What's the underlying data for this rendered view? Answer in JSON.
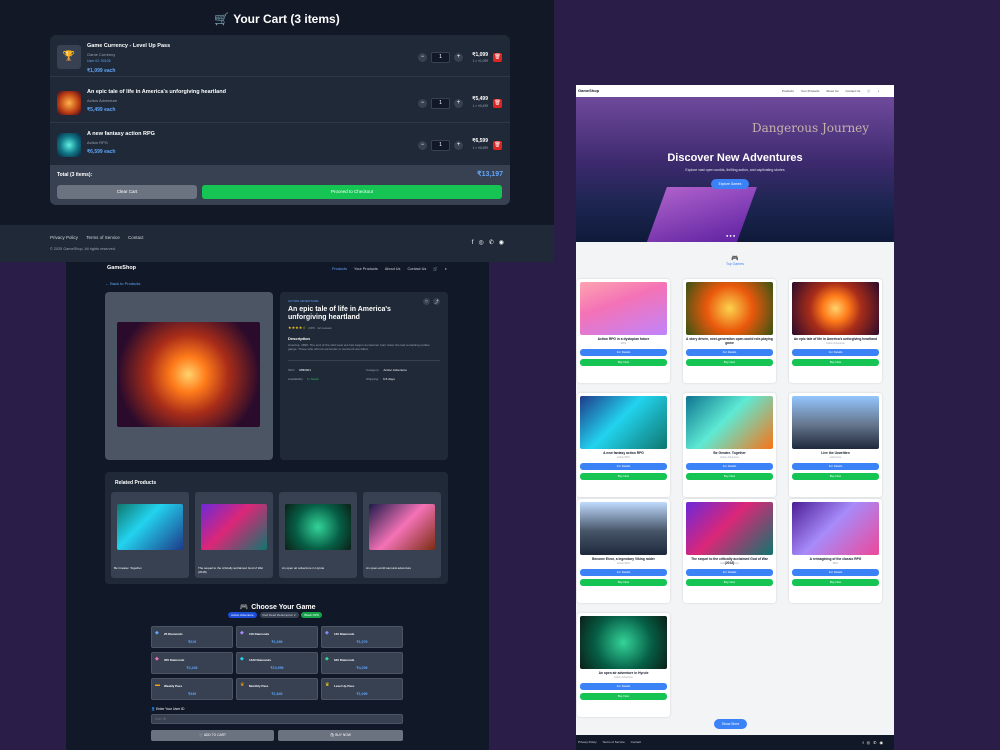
{
  "cart": {
    "title": "Your Cart (3 items)",
    "items": [
      {
        "name": "Game Currency - Level Up Pass",
        "category": "Game Currency",
        "user_id": "User ID: 90105",
        "price": "₹1,099 each",
        "qty": "1",
        "line_total": "₹1,099",
        "line_sub": "1 × ₹1,099"
      },
      {
        "name": "An epic tale of life in America's unforgiving heartland",
        "category": "Action Adventure",
        "user_id": "",
        "price": "₹5,499 each",
        "qty": "1",
        "line_total": "₹5,499",
        "line_sub": "1 × ₹5,499"
      },
      {
        "name": "A new fantasy action RPG",
        "category": "Action RPG",
        "user_id": "",
        "price": "₹6,599 each",
        "qty": "1",
        "line_total": "₹6,599",
        "line_sub": "1 × ₹6,599"
      }
    ],
    "total_label": "Total (3 items):",
    "total_value": "₹13,197",
    "clear_label": "Clear Cart",
    "checkout_label": "Proceed to Checkout",
    "footer_links": [
      "Privacy Policy",
      "Terms of Service",
      "Contact"
    ],
    "copyright": "© 2025 GameShop. All rights reserved."
  },
  "detail": {
    "brand": "GameShop",
    "nav": [
      "Products",
      "Your Products",
      "About Us",
      "Contact Us"
    ],
    "back": "← Back to Products",
    "tag": "ACTION ADVENTURE",
    "title": "An epic tale of life in America's unforgiving heartland",
    "rating": "4.5/5 · 12 reviews",
    "description_heading": "Description",
    "description": "America, 1899. The end of the wild west era has begun as lawmen hunt down the last remaining outlaw gangs. Those who will not surrender or succumb are killed.",
    "specs": [
      {
        "label": "SKU:",
        "value": "RBD001"
      },
      {
        "label": "Category:",
        "value": "Action Adventure"
      },
      {
        "label": "Availability:",
        "value": "In Stock"
      },
      {
        "label": "Shipping:",
        "value": "3-5 days"
      }
    ],
    "related_heading": "Related Products",
    "related": [
      {
        "name": "Be Greater. Together"
      },
      {
        "name": "The sequel to the critically acclaimed God of War (2018)"
      },
      {
        "name": "An open air adventure in Hyrule"
      },
      {
        "name": "An open-world samurai adventure"
      }
    ],
    "choose_heading": "Choose Your Game",
    "tabs": [
      "Action Adventure",
      "Red Dead Redemption 2",
      "Black OPS"
    ],
    "tiles": [
      {
        "name": "25 Diamonds",
        "price": "₹219",
        "icon": "gem-icon"
      },
      {
        "name": "110 Diamonds",
        "price": "₹1,099",
        "icon": "gem-icon"
      },
      {
        "name": "140 Diamonds",
        "price": "₹1,079",
        "icon": "gem-icon"
      },
      {
        "name": "355 Diamonds",
        "price": "₹2,449",
        "icon": "gem-icon"
      },
      {
        "name": "1420 Diamonds",
        "price": "₹10,999",
        "icon": "gem-icon"
      },
      {
        "name": "640 Diamonds",
        "price": "₹4,299",
        "icon": "gem-icon"
      },
      {
        "name": "Weekly Pass",
        "price": "₹349",
        "icon": "ticket-icon"
      },
      {
        "name": "Monthly Pass",
        "price": "₹1,849",
        "icon": "crown-icon"
      },
      {
        "name": "Level Up Pass",
        "price": "₹1,099",
        "icon": "crown-icon"
      }
    ],
    "uid_label": "Enter Your User ID",
    "uid_placeholder": "User ID",
    "add_label": "ADD TO CART",
    "buy_label": "BUY NOW"
  },
  "store": {
    "brand": "GameShop",
    "nav": [
      "Products",
      "Your Products",
      "About Us",
      "Contact Us"
    ],
    "hero_word": "Dangerous Journey",
    "hero_title": "Discover New Adventures",
    "hero_sub": "Explore vast open worlds, thrilling action, and captivating stories",
    "hero_button": "Explore Games",
    "top_games": "Top Games",
    "games": [
      {
        "name": "Action RPG in a dystopian future",
        "cat": "RPG"
      },
      {
        "name": "A story driven, next-generation open-world role-playing game",
        "cat": "RPG"
      },
      {
        "name": "An epic tale of life in America's unforgiving heartland",
        "cat": "Action Adventure"
      },
      {
        "name": "A new fantasy action RPG",
        "cat": "Action RPG"
      },
      {
        "name": "Be Greater. Together",
        "cat": "Action Adventure"
      },
      {
        "name": "Live the Unwritten",
        "cat": "Adventure"
      },
      {
        "name": "Become Eivor, a legendary Viking raider",
        "cat": "Action RPG"
      },
      {
        "name": "The sequel to the critically acclaimed God of War (2018)",
        "cat": "Action Adventure"
      },
      {
        "name": "A reimagining of the classic RPG",
        "cat": "RPG"
      },
      {
        "name": "An open air adventure in Hyrule",
        "cat": "Action Adventure"
      }
    ],
    "details_label": "For Details",
    "buy_label": "Buy Now",
    "show_more": "Show More",
    "footer_links": [
      "Privacy Policy",
      "Terms of Service",
      "Contact"
    ]
  }
}
